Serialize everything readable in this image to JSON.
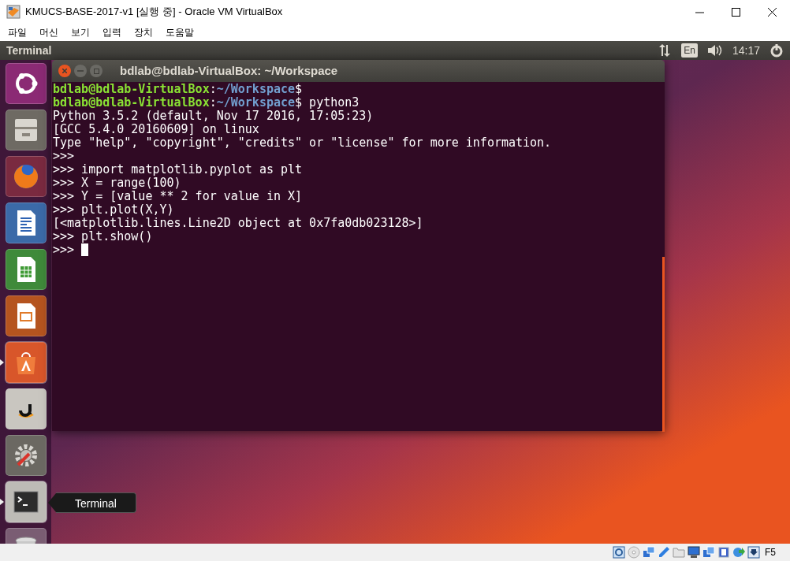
{
  "host_window": {
    "title": "KMUCS-BASE-2017-v1 [실행 중] - Oracle VM VirtualBox"
  },
  "menu": [
    "파일",
    "머신",
    "보기",
    "입력",
    "장치",
    "도움말"
  ],
  "top_panel": {
    "app_name": "Terminal",
    "keyboard_layout": "En",
    "clock": "14:17"
  },
  "launcher": [
    {
      "kind": "dash",
      "running": false
    },
    {
      "kind": "files",
      "running": false
    },
    {
      "kind": "browser",
      "running": false
    },
    {
      "kind": "writer",
      "running": false
    },
    {
      "kind": "calc",
      "running": false
    },
    {
      "kind": "impress",
      "running": false
    },
    {
      "kind": "software",
      "running": true
    },
    {
      "kind": "amazon",
      "running": false
    },
    {
      "kind": "settings",
      "running": false
    },
    {
      "kind": "terminal",
      "running": true
    },
    {
      "kind": "trash",
      "running": false
    }
  ],
  "tooltip": "Terminal",
  "terminal": {
    "title": "bdlab@bdlab-VirtualBox: ~/Workspace",
    "lines": [
      {
        "kind": "prompt",
        "user": "bdlab@bdlab-VirtualBox",
        "separator": ":",
        "path": "~/Workspace",
        "symbol": "$"
      },
      {
        "kind": "prompt",
        "user": "bdlab@bdlab-VirtualBox",
        "separator": ":",
        "path": "~/Workspace",
        "symbol": "$",
        "command": " python3"
      },
      {
        "kind": "output",
        "text": "Python 3.5.2 (default, Nov 17 2016, 17:05:23)"
      },
      {
        "kind": "output",
        "text": "[GCC 5.4.0 20160609] on linux"
      },
      {
        "kind": "output",
        "text": "Type \"help\", \"copyright\", \"credits\" or \"license\" for more information."
      },
      {
        "kind": "output",
        "text": ">>>"
      },
      {
        "kind": "output",
        "text": ">>> import matplotlib.pyplot as plt"
      },
      {
        "kind": "output",
        "text": ">>> X = range(100)"
      },
      {
        "kind": "output",
        "text": ">>> Y = [value ** 2 for value in X]"
      },
      {
        "kind": "output",
        "text": ">>> plt.plot(X,Y)"
      },
      {
        "kind": "output",
        "text": "[<matplotlib.lines.Line2D object at 0x7fa0db023128>]"
      },
      {
        "kind": "output",
        "text": ">>> plt.show()"
      },
      {
        "kind": "input",
        "text": ">>> "
      }
    ]
  },
  "status_bar": {
    "host_key": "F5"
  }
}
